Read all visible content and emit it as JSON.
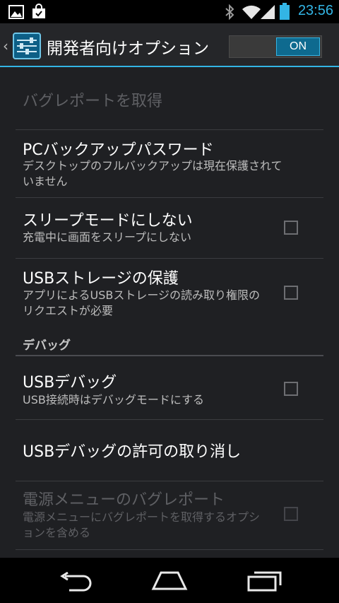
{
  "status_bar": {
    "time": "23:56",
    "icons": [
      "gallery-icon",
      "shopping-bag-icon",
      "bluetooth-icon",
      "wifi-icon",
      "signal-icon",
      "battery-icon"
    ],
    "time_color": "#33b5e5"
  },
  "action_bar": {
    "title": "開発者向けオプション",
    "switch_label": "ON",
    "accent": "#33b5e5"
  },
  "items": [
    {
      "title": "バグレポートを取得",
      "summary": "",
      "enabled": false,
      "checkbox": false
    },
    {
      "title": "PCバックアップパスワード",
      "summary": "デスクトップのフルバックアップは現在保護されていません",
      "enabled": true,
      "checkbox": false
    },
    {
      "title": "スリープモードにしない",
      "summary": "充電中に画面をスリープにしない",
      "enabled": true,
      "checkbox": true,
      "checked": false
    },
    {
      "title": "USBストレージの保護",
      "summary": "アプリによるUSBストレージの読み取り権限のリクエストが必要",
      "enabled": true,
      "checkbox": true,
      "checked": false
    },
    {
      "title": "USBデバッグ",
      "summary": "USB接続時はデバッグモードにする",
      "enabled": true,
      "checkbox": true,
      "checked": false
    },
    {
      "title": "USBデバッグの許可の取り消し",
      "summary": "",
      "enabled": true,
      "checkbox": false
    },
    {
      "title": "電源メニューのバグレポート",
      "summary": "電源メニューにバグレポートを取得するオプションを含める",
      "enabled": false,
      "checkbox": true,
      "checked": false
    }
  ],
  "sections": {
    "debug": "デバッグ"
  },
  "nav_bar": {
    "back": "back-icon",
    "home": "home-icon",
    "recents": "recents-icon"
  }
}
